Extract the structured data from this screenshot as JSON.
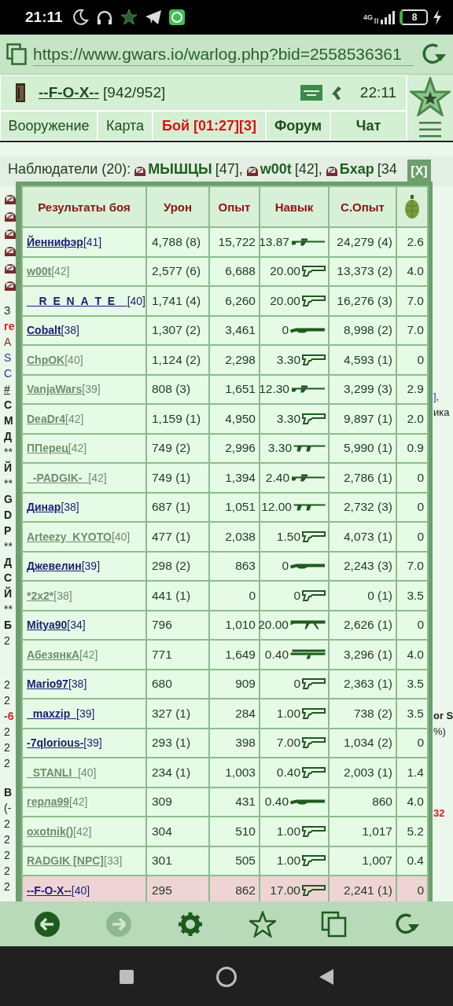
{
  "status_bar": {
    "time": "21:11",
    "network": "4G",
    "battery": "8"
  },
  "browser": {
    "url": "https://www.gwars.io/warlog.php?bid=2558536361"
  },
  "header": {
    "player": "--F-O-X--",
    "hp": "[942/952]",
    "clock": "22:11"
  },
  "tabs": [
    {
      "label": "Вооружение",
      "kind": "normal"
    },
    {
      "label": "Карта",
      "kind": "normal"
    },
    {
      "label": "Бой [01:27][3]",
      "kind": "alert"
    },
    {
      "label": "Форум",
      "kind": "bold"
    },
    {
      "label": "Чат",
      "kind": "bold"
    }
  ],
  "observers": {
    "label": "Наблюдатели (20):",
    "people": [
      {
        "name": "МЫШЦЫ",
        "level": "[47],"
      },
      {
        "name": "w00t",
        "level": "[42],"
      },
      {
        "name": "Бхар",
        "level": "[34"
      }
    ]
  },
  "left_fragments": [
    [
      {
        "text": "З",
        "kind": "plain"
      },
      {
        "text": "ге",
        "kind": "red"
      },
      {
        "text": "А",
        "kind": "brown"
      },
      {
        "text": "S",
        "kind": "blue"
      },
      {
        "text": "С",
        "kind": "blue"
      },
      {
        "text": "#",
        "kind": "link"
      },
      {
        "text": "С",
        "kind": "bold"
      },
      {
        "text": "М",
        "kind": "bold"
      },
      {
        "text": "Д",
        "kind": "bold"
      },
      {
        "text": "**",
        "kind": "plain"
      },
      {
        "text": "Й",
        "kind": "bold"
      },
      {
        "text": "**",
        "kind": "plain"
      },
      {
        "text": "G",
        "kind": "bold"
      },
      {
        "text": "D",
        "kind": "bold"
      },
      {
        "text": "Р",
        "kind": "bold"
      },
      {
        "text": "**",
        "kind": "plain"
      },
      {
        "text": "Д",
        "kind": "bold"
      },
      {
        "text": "С",
        "kind": "bold"
      },
      {
        "text": "Й",
        "kind": "bold"
      },
      {
        "text": "**",
        "kind": "plain"
      },
      {
        "text": "Б",
        "kind": "bold"
      },
      {
        "text": "2",
        "kind": "plain"
      }
    ],
    [
      {
        "text": "2",
        "kind": "plain"
      },
      {
        "text": "2",
        "kind": "plain"
      },
      {
        "text": "-6",
        "kind": "red"
      },
      {
        "text": "2",
        "kind": "plain"
      },
      {
        "text": "2",
        "kind": "plain"
      },
      {
        "text": "2",
        "kind": "plain"
      }
    ],
    [
      {
        "text": "В",
        "kind": "bold"
      },
      {
        "text": "(-",
        "kind": "plain"
      },
      {
        "text": "2",
        "kind": "plain"
      },
      {
        "text": "2",
        "kind": "plain"
      },
      {
        "text": "2",
        "kind": "plain"
      },
      {
        "text": "2",
        "kind": "plain"
      },
      {
        "text": "2",
        "kind": "plain"
      }
    ]
  ],
  "right_fragments": [
    [
      {
        "text": "],",
        "kind": "blue"
      },
      {
        "text": "ика",
        "kind": "plain"
      }
    ],
    [
      {
        "text": "or S",
        "kind": "bold"
      },
      {
        "text": "%)",
        "kind": "plain"
      }
    ],
    [
      {
        "text": "32",
        "kind": "red"
      }
    ]
  ],
  "close_label": "[X]",
  "results": {
    "columns": [
      "Результаты боя",
      "Урон",
      "Опыт",
      "Навык",
      "С.Опыт"
    ],
    "rows": [
      {
        "name": "Йеннифэр",
        "level": "[41]",
        "color": "#1a1f72",
        "current": false,
        "damage": "4,788 (8)",
        "exp": "15,722",
        "skill": {
          "value": "13.87",
          "kind": "sniper"
        },
        "cexp": "24,279 (4)",
        "grenade": "2.6"
      },
      {
        "name": "w00t",
        "level": "[42]",
        "color": "#6e8f6e",
        "current": false,
        "damage": "2,577 (6)",
        "exp": "6,688",
        "skill": {
          "value": "20.00",
          "kind": "pistol"
        },
        "cexp": "13,373 (2)",
        "grenade": "4.0"
      },
      {
        "name": "__R_E_N_A_T_E__",
        "level": "[40]",
        "color": "#1a1f72",
        "current": false,
        "damage": "1,741 (4)",
        "exp": "6,260",
        "skill": {
          "value": "20.00",
          "kind": "pistol"
        },
        "cexp": "16,276 (3)",
        "grenade": "7.0"
      },
      {
        "name": "Cobalt",
        "level": "[38]",
        "color": "#1a1f72",
        "current": false,
        "damage": "1,307 (2)",
        "exp": "3,461",
        "skill": {
          "value": "0",
          "kind": "shotgun"
        },
        "cexp": "8,998 (2)",
        "grenade": "7.0"
      },
      {
        "name": "ChpOK",
        "level": "[40]",
        "color": "#6e8f6e",
        "current": false,
        "damage": "1,124 (2)",
        "exp": "2,298",
        "skill": {
          "value": "3.30",
          "kind": "pistol"
        },
        "cexp": "4,593 (1)",
        "grenade": "0"
      },
      {
        "name": "VanjaWars",
        "level": "[39]",
        "color": "#6e8f6e",
        "current": false,
        "damage": "808 (3)",
        "exp": "1,651",
        "skill": {
          "value": "12.30",
          "kind": "sniper"
        },
        "cexp": "3,299 (3)",
        "grenade": "2.9"
      },
      {
        "name": "DeaDr4",
        "level": "[42]",
        "color": "#6e8f6e",
        "current": false,
        "damage": "1,159 (1)",
        "exp": "4,950",
        "skill": {
          "value": "3.30",
          "kind": "pistol"
        },
        "cexp": "9,897 (1)",
        "grenade": "2.0"
      },
      {
        "name": "ППерец",
        "level": "[42]",
        "color": "#6e8f6e",
        "current": false,
        "damage": "749 (2)",
        "exp": "2,996",
        "skill": {
          "value": "3.30",
          "kind": "smg"
        },
        "cexp": "5,990 (1)",
        "grenade": "0.9"
      },
      {
        "name": "_-PADGIK-_",
        "level": "[42]",
        "color": "#6e8f6e",
        "current": false,
        "damage": "749 (1)",
        "exp": "1,394",
        "skill": {
          "value": "2.40",
          "kind": "sniper"
        },
        "cexp": "2,786 (1)",
        "grenade": "0"
      },
      {
        "name": "Динар",
        "level": "[38]",
        "color": "#1a1f72",
        "current": false,
        "damage": "687 (1)",
        "exp": "1,051",
        "skill": {
          "value": "12.00",
          "kind": "smg"
        },
        "cexp": "2,732 (3)",
        "grenade": "0"
      },
      {
        "name": "Arteezy_KYOTO",
        "level": "[40]",
        "color": "#6e8f6e",
        "current": false,
        "damage": "477 (1)",
        "exp": "2,038",
        "skill": {
          "value": "1.50",
          "kind": "pistol"
        },
        "cexp": "4,073 (1)",
        "grenade": "0"
      },
      {
        "name": "Джевелин",
        "level": "[39]",
        "color": "#1a1f72",
        "current": false,
        "damage": "298 (2)",
        "exp": "863",
        "skill": {
          "value": "0",
          "kind": "shotgun"
        },
        "cexp": "2,243 (3)",
        "grenade": "7.0"
      },
      {
        "name": "*2x2*",
        "level": "[38]",
        "color": "#6e8f6e",
        "current": false,
        "damage": "441 (1)",
        "exp": "0",
        "skill": {
          "value": "0",
          "kind": "pistol"
        },
        "cexp": "0 (1)",
        "grenade": "3.5"
      },
      {
        "name": "Mitya90",
        "level": "[34]",
        "color": "#1a1f72",
        "current": false,
        "damage": "796",
        "exp": "1,010",
        "skill": {
          "value": "20.00",
          "kind": "machinegun"
        },
        "cexp": "2,626 (1)",
        "grenade": "0"
      },
      {
        "name": "АбезянкА",
        "level": "[42]",
        "color": "#6e8f6e",
        "current": false,
        "damage": "771",
        "exp": "1,649",
        "skill": {
          "value": "0.40",
          "kind": "launcher"
        },
        "cexp": "3,296 (1)",
        "grenade": "4.0"
      },
      {
        "name": "Mario97",
        "level": "[38]",
        "color": "#1a1f72",
        "current": false,
        "damage": "680",
        "exp": "909",
        "skill": {
          "value": "0",
          "kind": "pistol"
        },
        "cexp": "2,363 (1)",
        "grenade": "3.5"
      },
      {
        "name": "_maxzip_",
        "level": "[39]",
        "color": "#1a1f72",
        "current": false,
        "damage": "327 (1)",
        "exp": "284",
        "skill": {
          "value": "1.00",
          "kind": "pistol"
        },
        "cexp": "738 (2)",
        "grenade": "3.5"
      },
      {
        "name": "-7qlorious-",
        "level": "[39]",
        "color": "#1a1f72",
        "current": false,
        "damage": "293 (1)",
        "exp": "398",
        "skill": {
          "value": "7.00",
          "kind": "pistol"
        },
        "cexp": "1,034 (2)",
        "grenade": "0"
      },
      {
        "name": "_STANLI_",
        "level": "[40]",
        "color": "#6e8f6e",
        "current": false,
        "damage": "234 (1)",
        "exp": "1,003",
        "skill": {
          "value": "0.40",
          "kind": "pistol"
        },
        "cexp": "2,003 (1)",
        "grenade": "1.4"
      },
      {
        "name": "герла99",
        "level": "[42]",
        "color": "#6e8f6e",
        "current": false,
        "damage": "309",
        "exp": "431",
        "skill": {
          "value": "0.40",
          "kind": "shotgun"
        },
        "cexp": "860",
        "grenade": "4.0"
      },
      {
        "name": "oxotnik()",
        "level": "[42]",
        "color": "#6e8f6e",
        "current": false,
        "damage": "304",
        "exp": "510",
        "skill": {
          "value": "1.00",
          "kind": "pistol"
        },
        "cexp": "1,017",
        "grenade": "5.2"
      },
      {
        "name": "RADGIK [NPC]",
        "level": "[33]",
        "color": "#6e8f6e",
        "current": false,
        "damage": "301",
        "exp": "505",
        "skill": {
          "value": "1.00",
          "kind": "pistol"
        },
        "cexp": "1,007",
        "grenade": "0.4"
      },
      {
        "name": "--F-O-X--",
        "level": "[40]",
        "color": "#1a1f72",
        "current": true,
        "damage": "295",
        "exp": "862",
        "skill": {
          "value": "17.00",
          "kind": "pistol"
        },
        "cexp": "2,241 (1)",
        "grenade": "0"
      }
    ]
  },
  "bottom_nav": [
    {
      "kind": "back",
      "disabled": false
    },
    {
      "kind": "forward",
      "disabled": true
    },
    {
      "kind": "settings",
      "disabled": false
    },
    {
      "kind": "star",
      "disabled": false
    },
    {
      "kind": "tabs",
      "disabled": false
    },
    {
      "kind": "reload",
      "disabled": false
    }
  ]
}
